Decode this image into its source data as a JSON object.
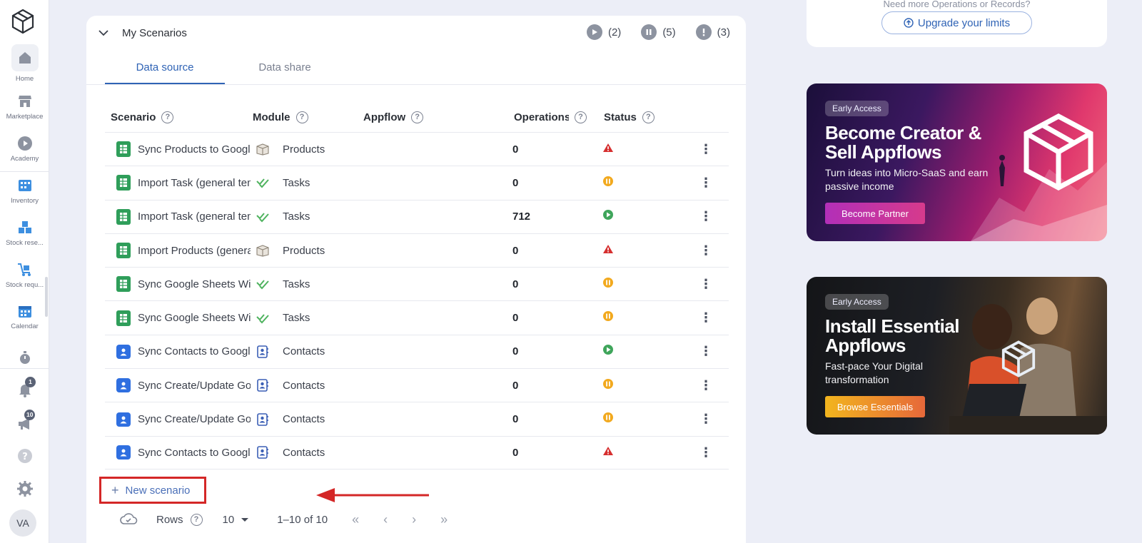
{
  "sidebar": {
    "items": [
      {
        "label": "Home"
      },
      {
        "label": "Marketplace"
      },
      {
        "label": "Academy"
      },
      {
        "label": "Inventory"
      },
      {
        "label": "Stock rese..."
      },
      {
        "label": "Stock requ..."
      },
      {
        "label": "Calendar"
      }
    ],
    "notifications_badge": "1",
    "announcements_badge": "10",
    "avatar_initials": "VA"
  },
  "card": {
    "title": "My Scenarios",
    "counters": {
      "running": "(2)",
      "paused": "(5)",
      "errors": "(3)"
    },
    "tabs": [
      {
        "label": "Data source",
        "active": true
      },
      {
        "label": "Data share",
        "active": false
      }
    ],
    "columns": {
      "scenario": "Scenario",
      "module": "Module",
      "appflow": "Appflow",
      "operations": "Operations",
      "status": "Status"
    },
    "rows": [
      {
        "scenario": "Sync Products to Google Sheets",
        "icon": "sheet-icon",
        "module": "Products",
        "module_icon": "box-icon",
        "operations": "0",
        "status": "error"
      },
      {
        "scenario": "Import Task (general template)",
        "icon": "sheet-icon",
        "module": "Tasks",
        "module_icon": "check-icon",
        "operations": "0",
        "status": "paused"
      },
      {
        "scenario": "Import Task (general template)",
        "icon": "sheet-icon",
        "module": "Tasks",
        "module_icon": "check-icon",
        "operations": "712",
        "status": "running"
      },
      {
        "scenario": "Import Products (general template)",
        "icon": "sheet-icon",
        "module": "Products",
        "module_icon": "box-icon",
        "operations": "0",
        "status": "error"
      },
      {
        "scenario": "Sync Google Sheets With Tasks",
        "icon": "sheet-icon",
        "module": "Tasks",
        "module_icon": "check-icon",
        "operations": "0",
        "status": "paused"
      },
      {
        "scenario": "Sync Google Sheets With Tasks",
        "icon": "sheet-icon",
        "module": "Tasks",
        "module_icon": "check-icon",
        "operations": "0",
        "status": "paused"
      },
      {
        "scenario": "Sync Contacts to Google Contacts",
        "icon": "contact-icon",
        "module": "Contacts",
        "module_icon": "contact-card-icon",
        "operations": "0",
        "status": "running"
      },
      {
        "scenario": "Sync Create/Update Google Contacts",
        "icon": "contact-icon",
        "module": "Contacts",
        "module_icon": "contact-card-icon",
        "operations": "0",
        "status": "paused"
      },
      {
        "scenario": "Sync Create/Update Google Contacts",
        "icon": "contact-icon",
        "module": "Contacts",
        "module_icon": "contact-card-icon",
        "operations": "0",
        "status": "paused"
      },
      {
        "scenario": "Sync Contacts to Google Contacts",
        "icon": "contact-icon",
        "module": "Contacts",
        "module_icon": "contact-card-icon",
        "operations": "0",
        "status": "error"
      }
    ],
    "new_scenario_label": "New scenario",
    "pager": {
      "rows_label": "Rows",
      "rows_value": "10",
      "range": "1–10 of 10"
    }
  },
  "upgrade": {
    "top_text": "Need more Operations or Records?",
    "button_label": "Upgrade your limits"
  },
  "promos": [
    {
      "chip": "Early Access",
      "title": "Become Creator & Sell Appflows",
      "subtitle": "Turn ideas into Micro-SaaS and earn passive income",
      "button": "Become Partner"
    },
    {
      "chip": "Early Access",
      "title": "Install Essential Appflows",
      "subtitle": "Fast-pace Your Digital transformation",
      "button": "Browse Essentials"
    }
  ],
  "colors": {
    "accent": "#2f63b5",
    "status_error": "#d62f2f",
    "status_paused": "#f2a91e",
    "status_running": "#3fa55b",
    "highlight": "#d42727"
  }
}
